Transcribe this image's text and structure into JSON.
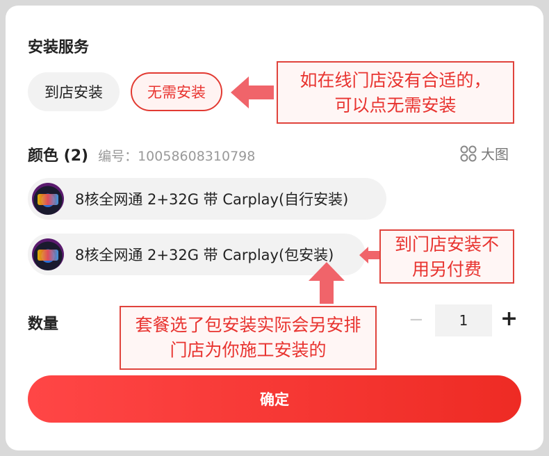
{
  "install_service": {
    "title": "安装服务",
    "options": [
      {
        "label": "到店安装",
        "selected": false
      },
      {
        "label": "无需安装",
        "selected": true
      }
    ]
  },
  "color": {
    "title": "颜色 (2)",
    "code_label": "编号：",
    "code_value": "10058608310798",
    "view_large_label": "大图",
    "options": [
      {
        "label": "8核全网通 2+32G 带 Carplay(自行安装)"
      },
      {
        "label": "8核全网通 2+32G 带 Carplay(包安装)"
      }
    ]
  },
  "quantity": {
    "title": "数量",
    "minus": "−",
    "value": "1",
    "plus": "+"
  },
  "confirm_label": "确定",
  "annotations": {
    "no_install_note": "如在线门店没有合适的，可以点无需安装",
    "store_install_note": "到门店安装不用另付费",
    "package_note": "套餐选了包安装实际会另安排门店为你施工安装的"
  },
  "colors": {
    "accent": "#e8332f",
    "button_gradient_start": "#ff4646",
    "button_gradient_end": "#ee2b24"
  }
}
